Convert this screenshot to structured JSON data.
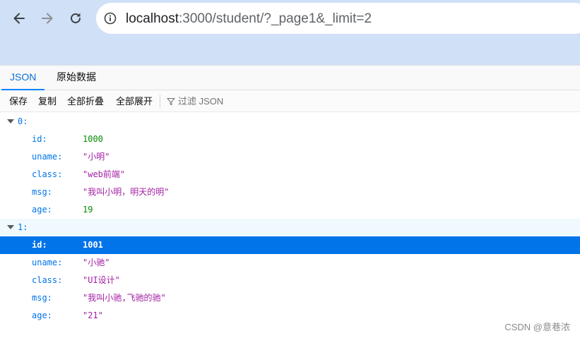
{
  "browser": {
    "back_icon": "arrow-left-icon",
    "forward_icon": "arrow-right-icon",
    "reload_icon": "reload-icon",
    "site_info_icon": "info-circle-icon",
    "url_host": "localhost",
    "url_rest": ":3000/student/?_page1&_limit=2"
  },
  "viewer": {
    "tabs": [
      {
        "label": "JSON",
        "active": true
      },
      {
        "label": "原始数据",
        "active": false
      }
    ],
    "toolbar": {
      "save": "保存",
      "copy": "复制",
      "collapse_all": "全部折叠",
      "expand_all": "全部展开",
      "filter_icon": "funnel-icon",
      "filter_placeholder": "过滤 JSON"
    }
  },
  "json_tree": {
    "items": [
      {
        "index": "0:",
        "fields": [
          {
            "key": "id:",
            "value": "1000",
            "type": "number"
          },
          {
            "key": "uname:",
            "value": "\"小明\"",
            "type": "string"
          },
          {
            "key": "class:",
            "value": "\"web前端\"",
            "type": "string"
          },
          {
            "key": "msg:",
            "value": "\"我叫小明，明天的明\"",
            "type": "string"
          },
          {
            "key": "age:",
            "value": "19",
            "type": "number"
          }
        ]
      },
      {
        "index": "1:",
        "fields": [
          {
            "key": "id:",
            "value": "1001",
            "type": "number"
          },
          {
            "key": "uname:",
            "value": "\"小驰\"",
            "type": "string"
          },
          {
            "key": "class:",
            "value": "\"UI设计\"",
            "type": "string"
          },
          {
            "key": "msg:",
            "value": "\"我叫小驰,飞驰的驰\"",
            "type": "string"
          },
          {
            "key": "age:",
            "value": "\"21\"",
            "type": "string"
          }
        ]
      }
    ]
  },
  "colors": {
    "chrome_bg": "#cfe0f7",
    "key": "#0074e8",
    "number": "#058b00",
    "string": "#a21ea2",
    "selected_row": "#0074e8",
    "hover_row": "#f0f9fe"
  },
  "watermark": "CSDN @意巷浓"
}
